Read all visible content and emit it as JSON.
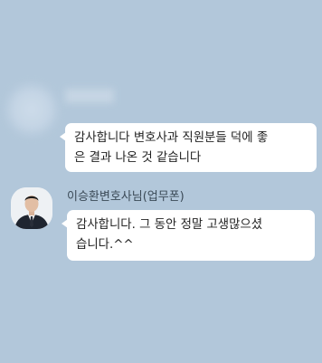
{
  "messages": [
    {
      "sender": "",
      "lines": [
        "감사합니다 변호사과 직원분들 덕에 좋",
        "은 결과 나온 것 같습니다"
      ]
    },
    {
      "sender": "이승환변호사님(업무폰)",
      "lines": [
        "감사합니다. 그 동안 정말 고생많으셨",
        "습니다.^^"
      ]
    }
  ],
  "colors": {
    "background": "#b2c7da",
    "bubble": "#ffffff",
    "text": "#222222"
  }
}
